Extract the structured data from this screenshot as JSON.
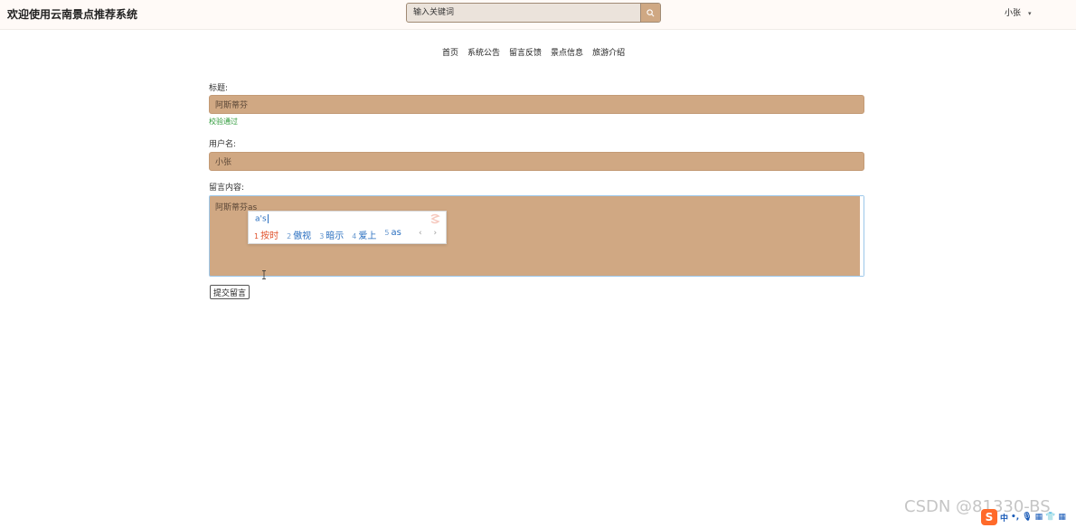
{
  "header": {
    "title": "欢迎使用云南景点推荐系统",
    "search_placeholder": "输入关键词",
    "user_name": "小张",
    "user_caret": "▾"
  },
  "nav": {
    "items": [
      "首页",
      "系统公告",
      "留言反馈",
      "景点信息",
      "旅游介绍"
    ]
  },
  "form": {
    "title_label": "标题:",
    "title_value": "阿斯蒂芬",
    "title_valid_msg": "校验通过",
    "username_label": "用户名:",
    "username_value": "小张",
    "content_label": "留言内容:",
    "content_value": "阿斯蒂芬as",
    "submit_label": "提交留言"
  },
  "ime": {
    "composition": "a's",
    "candidates": [
      {
        "num": "1",
        "text": "按时"
      },
      {
        "num": "2",
        "text": "傲视"
      },
      {
        "num": "3",
        "text": "暗示"
      },
      {
        "num": "4",
        "text": "爱上"
      },
      {
        "num": "5",
        "text": "as"
      }
    ],
    "arrows": "‹ ›",
    "toolbar": {
      "logo": "S",
      "lang": "中",
      "punct": "•,",
      "mic": "🎙",
      "keyboard": "▦",
      "skin": "👕",
      "menu": "▦"
    }
  },
  "watermark": "CSDN @81330-BS",
  "colors": {
    "field_bg": "#d0a883",
    "search_button": "#cfa883",
    "valid_green": "#2e9a3a",
    "ime_blue": "#2a6fc0",
    "ime_first": "#e0502a"
  },
  "icons": {
    "search": "search-icon",
    "text_cursor": "I-beam"
  }
}
